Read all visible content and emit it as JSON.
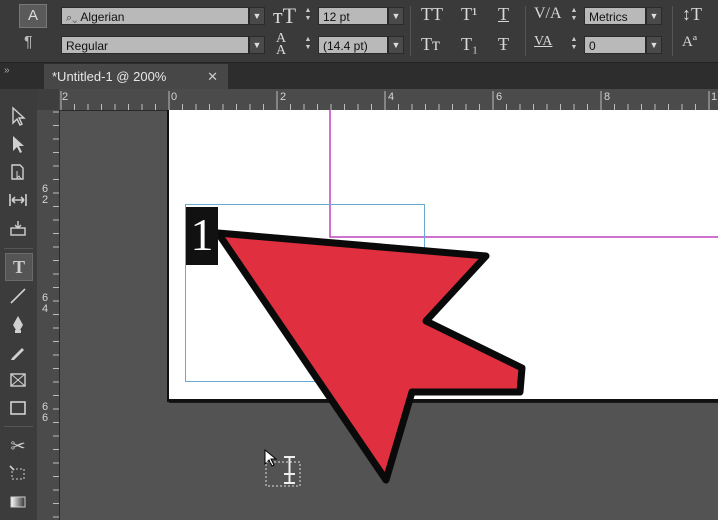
{
  "control_panel": {
    "char_icon": "A",
    "para_icon": "¶",
    "font_family": "Algerian",
    "font_style": "Regular",
    "font_size": "12 pt",
    "leading": "(14.4 pt)",
    "kerning": "Metrics",
    "tracking": "0",
    "caps_all": "TT",
    "caps_small": "Tт",
    "superscript": "T¹",
    "subscript": "T₁",
    "underline": "T",
    "strikethrough": "Ŧ"
  },
  "document": {
    "tab_title": "*Untitled-1 @ 200%",
    "close_glyph": "✕"
  },
  "rulers": {
    "horizontal_labels": [
      "2",
      "0",
      "2",
      "4",
      "6",
      "8",
      "1"
    ],
    "vertical_labels": [
      "6\n2",
      "6\n4",
      "6\n6"
    ]
  },
  "tools": [
    "selection-tool",
    "direct-selection-tool",
    "page-tool",
    "gap-tool",
    "content-collector-tool",
    "type-tool",
    "line-tool",
    "pen-tool",
    "pencil-tool",
    "rectangle-frame-tool",
    "rectangle-tool",
    "scissors-tool",
    "free-transform-tool",
    "gradient-swatch-tool"
  ],
  "annotation": {
    "step_number": "1",
    "arrow_color": "#e0303f"
  },
  "colors": {
    "guide": "#c040c0",
    "frame_edge": "#6aa9d0",
    "pasteboard": "#535353"
  }
}
